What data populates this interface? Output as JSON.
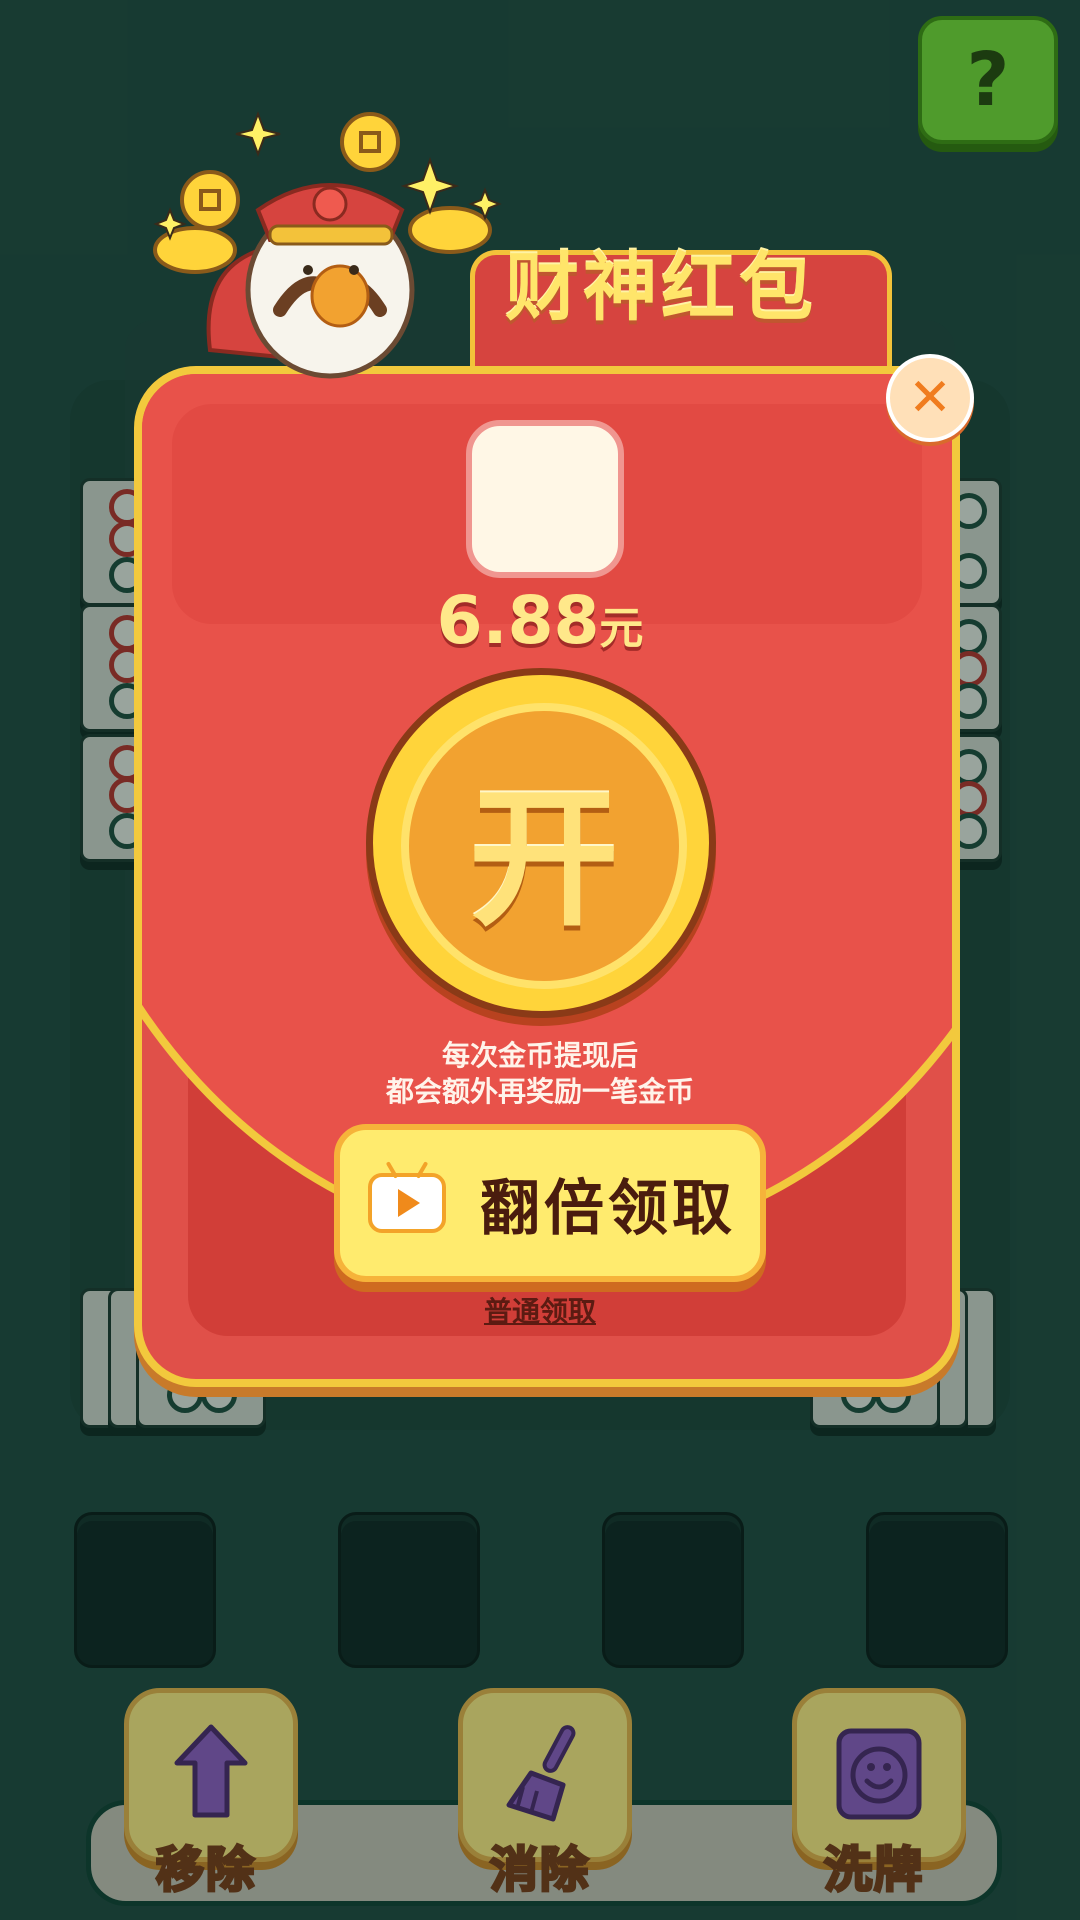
{
  "help": {
    "label": "?"
  },
  "packet": {
    "title": "财神红包",
    "amount_value": "6.88",
    "amount_unit": "元",
    "open_label": "开",
    "info_line1": "每次金币提现后",
    "info_line2": "都会额外再奖励一笔金币",
    "double_label": "翻倍领取",
    "normal_label": "普通领取",
    "close_label": "✕"
  },
  "toolbar": {
    "items": [
      {
        "label": "移除",
        "icon": "arrow-up-icon"
      },
      {
        "label": "消除",
        "icon": "broom-icon"
      },
      {
        "label": "洗牌",
        "icon": "shuffle-smile-icon"
      }
    ]
  },
  "colors": {
    "background": "#1f4a3f",
    "packet_red": "#e05049",
    "gold": "#ffd43a",
    "button_yellow": "#ffeb6e",
    "tool_icon_purple": "#8f5fc4"
  }
}
